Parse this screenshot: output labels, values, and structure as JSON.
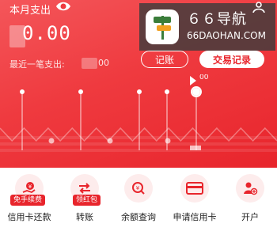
{
  "header": {
    "title": "本月支出",
    "amount": "0.00",
    "last_label": "最近一笔支出:",
    "last_value": "00",
    "btn_jizhang": "记账",
    "btn_record": "交易记录"
  },
  "watermark": {
    "title": "６６导航",
    "url": "66DAOHAN.COM"
  },
  "chart_data": {
    "type": "line",
    "selected_label": "00",
    "series": [
      {
        "values": [
          0.02,
          0.0,
          0.02,
          0.0,
          0.02,
          0.0,
          0.02,
          0.0,
          0.02,
          0.0,
          0.02,
          0.0,
          0.02,
          0.0,
          0.02,
          0.0,
          0.02,
          0.0,
          0.02,
          0.0,
          0.02,
          0.0,
          0.02,
          0.0
        ]
      }
    ]
  },
  "services": [
    {
      "label": "信用卡还款",
      "badge": "免手续费",
      "icon": "hand-coin-icon"
    },
    {
      "label": "转账",
      "badge": "领红包",
      "icon": "transfer-arrows-icon"
    },
    {
      "label": "余额查询",
      "badge": "",
      "icon": "balance-query-icon"
    },
    {
      "label": "申请信用卡",
      "badge": "",
      "icon": "credit-card-icon"
    },
    {
      "label": "开户",
      "badge": "",
      "icon": "open-account-icon"
    }
  ],
  "colors": {
    "accent": "#e8252c",
    "header_start": "#f4565a",
    "header_end": "#e8252c"
  }
}
